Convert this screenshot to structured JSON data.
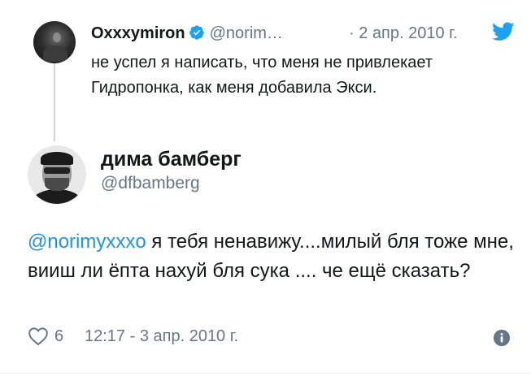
{
  "parent_tweet": {
    "author_name": "Oxxxymiron",
    "author_handle": "@norim…",
    "date": "· 2 апр. 2010 г.",
    "text": "не успел я написать, что меня не привлекает Гидропонка, как меня добавила Экси.",
    "verified": true
  },
  "main_tweet": {
    "author_name": "дима бамберг",
    "author_handle": "@dfbamberg",
    "mention": "@norimyxxxo",
    "text": " я тебя ненавижу....милый бля тоже мне, вииш ли ёпта нахуй бля сука .... че ещё сказать?",
    "like_count": "6",
    "timestamp": "12:17 - 3 апр. 2010 г."
  },
  "colors": {
    "link": "#1b95e0",
    "muted": "#657786",
    "verified": "#1da1f2",
    "thread_line": "#ccd6dd"
  },
  "icons": [
    "verified-badge-icon",
    "twitter-bird-icon",
    "heart-icon",
    "info-icon"
  ]
}
